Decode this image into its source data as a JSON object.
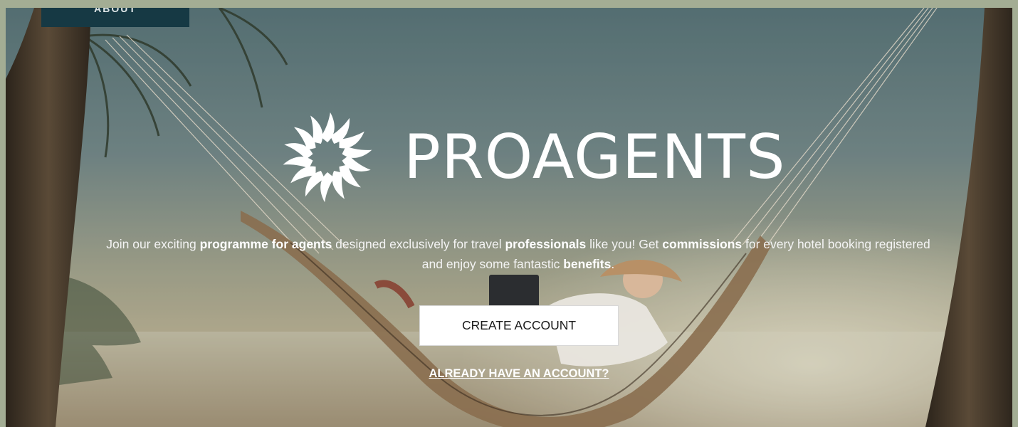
{
  "nav": {
    "tab_label": "ABOUT"
  },
  "brand": {
    "name": "PROAGENTS",
    "logo_icon": "sun-icon"
  },
  "hero": {
    "intro": [
      {
        "text": "Join our exciting ",
        "bold": false
      },
      {
        "text": "programme for agents",
        "bold": true
      },
      {
        "text": " designed exclusively for travel ",
        "bold": false
      },
      {
        "text": "professionals",
        "bold": true
      },
      {
        "text": " like you! Get ",
        "bold": false
      },
      {
        "text": "commissions",
        "bold": true
      },
      {
        "text": " for every hotel booking registered and enjoy some fantastic ",
        "bold": false
      },
      {
        "text": "benefits",
        "bold": true
      },
      {
        "text": ".",
        "bold": false
      }
    ],
    "create_account_label": "CREATE ACCOUNT",
    "login_link_label": "ALREADY HAVE AN ACCOUNT?"
  },
  "colors": {
    "page_border": "#a3ad94",
    "tab_background": "#163944",
    "button_background": "#ffffff",
    "text_on_image": "#ffffff"
  }
}
